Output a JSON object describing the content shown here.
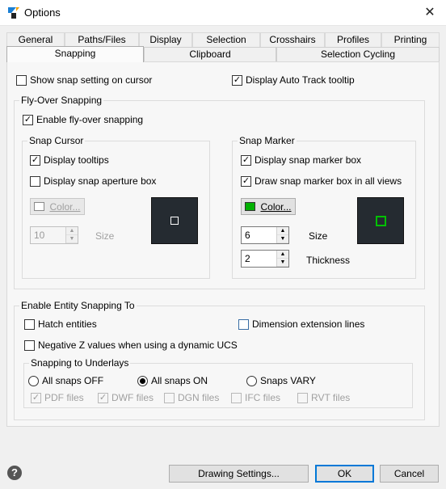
{
  "window": {
    "title": "Options",
    "app_icon": "app-logo-icon",
    "close_glyph": "✕"
  },
  "tabs_row1": [
    {
      "label": "General"
    },
    {
      "label": "Paths/Files"
    },
    {
      "label": "Display"
    },
    {
      "label": "Selection"
    },
    {
      "label": "Crosshairs"
    },
    {
      "label": "Profiles"
    },
    {
      "label": "Printing"
    }
  ],
  "tabs_row2": [
    {
      "label": "Snapping",
      "active": true
    },
    {
      "label": "Clipboard"
    },
    {
      "label": "Selection Cycling"
    }
  ],
  "top_options": {
    "show_snap_setting": {
      "label": "Show snap setting on cursor",
      "checked": false
    },
    "display_auto_track": {
      "label": "Display Auto Track tooltip",
      "checked": true
    }
  },
  "flyover": {
    "legend": "Fly-Over Snapping",
    "enable": {
      "label": "Enable fly-over snapping",
      "checked": true
    },
    "snap_cursor": {
      "legend": "Snap Cursor",
      "display_tooltips": {
        "label": "Display tooltips",
        "checked": true
      },
      "display_aperture": {
        "label": "Display snap aperture box",
        "checked": false
      },
      "color_button": "Color...",
      "color": "#ffffff",
      "size_value": "10",
      "size_label": "Size"
    },
    "snap_marker": {
      "legend": "Snap Marker",
      "display_marker_box": {
        "label": "Display snap marker box",
        "checked": true
      },
      "draw_in_all_views": {
        "label": "Draw snap marker box in all views",
        "checked": true
      },
      "color_button": "Color...",
      "color": "#00b000",
      "size_value": "6",
      "size_label": "Size",
      "thickness_value": "2",
      "thickness_label": "Thickness"
    }
  },
  "entity_snapping": {
    "legend": "Enable Entity Snapping To",
    "hatch": {
      "label": "Hatch entities",
      "checked": false
    },
    "dimension_ext": {
      "label": "Dimension extension lines",
      "checked": false
    },
    "negative_z": {
      "label": "Negative Z values when using a dynamic UCS",
      "checked": false
    },
    "underlays": {
      "legend": "Snapping to Underlays",
      "radios": [
        {
          "label": "All snaps OFF",
          "selected": false
        },
        {
          "label": "All snaps ON",
          "selected": true
        },
        {
          "label": "Snaps VARY",
          "selected": false
        }
      ],
      "files": [
        {
          "label": "PDF files",
          "checked": true
        },
        {
          "label": "DWF files",
          "checked": true
        },
        {
          "label": "DGN files",
          "checked": false
        },
        {
          "label": "IFC files",
          "checked": false
        },
        {
          "label": "RVT files",
          "checked": false
        }
      ]
    }
  },
  "buttons": {
    "drawing_settings": "Drawing Settings...",
    "ok": "OK",
    "cancel": "Cancel",
    "help": "?"
  },
  "check_glyph": "✓"
}
